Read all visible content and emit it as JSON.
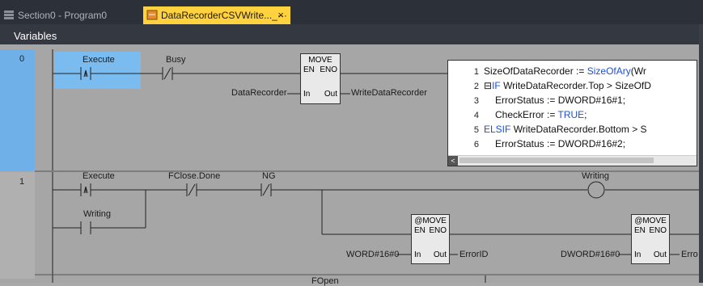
{
  "tabs": [
    {
      "label": "Section0 - Program0",
      "active": false,
      "icon": "program-icon"
    },
    {
      "label": "DataRecorderCSVWrite..._···",
      "active": true,
      "icon": "function-block-icon",
      "close": "×"
    }
  ],
  "variables_bar": {
    "label": "Variables"
  },
  "colors": {
    "active_tab": "#ffd23e",
    "selection": "#6fb0e8",
    "keyword": "#1e4fd6"
  },
  "rungs": [
    {
      "number": "0",
      "contacts": [
        {
          "label": "Execute",
          "type": "rising-edge"
        },
        {
          "label": "Busy",
          "type": "normally-closed"
        }
      ],
      "move_block": {
        "title": "MOVE",
        "en": "EN",
        "eno": "ENO",
        "in": "In",
        "out": "Out"
      },
      "move_input": "DataRecorder",
      "move_output": "WriteDataRecorder",
      "st_code": [
        {
          "num": "1",
          "text": "SizeOfDataRecorder := ",
          "kw": "SizeOfAry",
          "rest": "(Wr"
        },
        {
          "num": "2",
          "pre": "⊟",
          "kw": "IF",
          "text": " WriteDataRecorder.Top > SizeOfD"
        },
        {
          "num": "3",
          "text": "ErrorStatus := DWORD#16#1;"
        },
        {
          "num": "4",
          "text": "CheckError := ",
          "kw": "TRUE",
          "rest": ";"
        },
        {
          "num": "5",
          "kw": "ELSIF",
          "text": " WriteDataRecorder.Bottom > S"
        },
        {
          "num": "6",
          "text": "ErrorStatus := DWORD#16#2;"
        }
      ]
    },
    {
      "number": "1",
      "contacts": [
        {
          "label": "Execute",
          "type": "rising-edge"
        },
        {
          "label": "FClose.Done",
          "type": "normally-closed"
        },
        {
          "label": "NG",
          "type": "normally-closed"
        },
        {
          "label": "Writing",
          "type": "normally-open"
        }
      ],
      "coil": "Writing",
      "move1": {
        "title": "@MOVE",
        "en": "EN",
        "eno": "ENO",
        "in": "In",
        "out": "Out",
        "input": "WORD#16#0",
        "output": "ErrorID"
      },
      "move2": {
        "title": "@MOVE",
        "en": "EN",
        "eno": "ENO",
        "in": "In",
        "out": "Out",
        "input": "DWORD#16#0",
        "output": "Erro"
      }
    }
  ],
  "next_rung_label": "FOpen"
}
